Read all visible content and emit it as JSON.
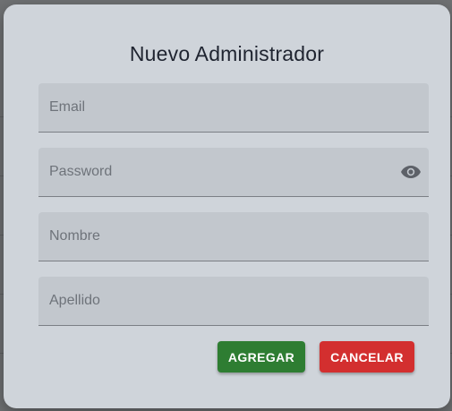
{
  "dialog": {
    "title": "Nuevo Administrador",
    "fields": {
      "email": {
        "placeholder": "Email",
        "value": ""
      },
      "password": {
        "placeholder": "Password",
        "value": "",
        "toggle_icon": "eye-icon"
      },
      "nombre": {
        "placeholder": "Nombre",
        "value": ""
      },
      "apellido": {
        "placeholder": "Apellido",
        "value": ""
      }
    },
    "buttons": {
      "add_label": "AGREGAR",
      "cancel_label": "CANCELAR"
    }
  },
  "colors": {
    "add_button": "#2e7d32",
    "cancel_button": "#d32f2f",
    "dialog_background": "#cfd4da",
    "field_background": "#c2c7cd"
  }
}
